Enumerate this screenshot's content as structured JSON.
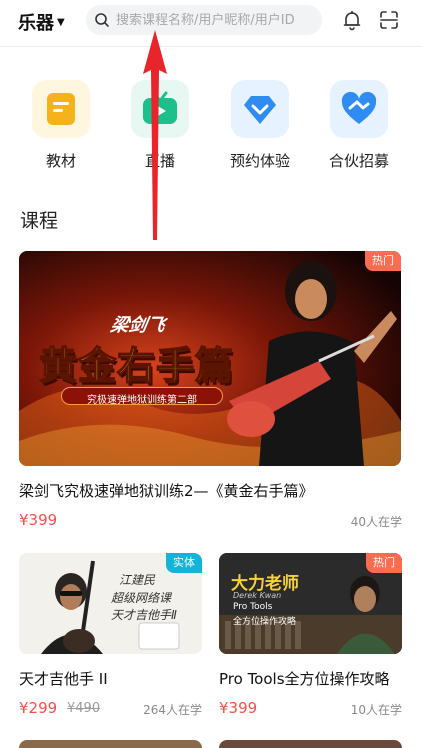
{
  "header": {
    "category_label": "乐器",
    "search_placeholder": "搜索课程名称/用户昵称/用户ID"
  },
  "quick_actions": [
    {
      "label": "教材"
    },
    {
      "label": "直播"
    },
    {
      "label": "预约体验"
    },
    {
      "label": "合伙招募"
    }
  ],
  "section": {
    "title": "课程"
  },
  "featured": {
    "badge": "热门",
    "banner_name": "梁剑飞",
    "banner_title": "黄金右手篇",
    "banner_subtitle": "究极速弹地狱训练第二部",
    "title": "梁剑飞究极速弹地狱训练2—《黄金右手篇》",
    "price": "¥399",
    "learners": "40人在学"
  },
  "cards": [
    {
      "badge": "实体",
      "calligraphy_lines": [
        "江建民",
        "超级网络课",
        "天才吉他手Ⅱ"
      ],
      "title": "天才吉他手 II",
      "price": "¥299",
      "old_price": "¥490",
      "learners": "264人在学"
    },
    {
      "badge": "热门",
      "banner_heading": "大力老师",
      "banner_name": "Derek Kwan",
      "banner_line1": "Pro Tools",
      "banner_line2": "全方位操作攻略",
      "title": "Pro Tools全方位操作攻略",
      "price": "¥399",
      "learners": "10人在学"
    }
  ],
  "colors": {
    "price": "#f5504d",
    "hot_badge": "#ff6b50",
    "physical_badge": "#14b4d8",
    "annotation_arrow": "#e8252b"
  },
  "icons": [
    "search-icon",
    "bell-icon",
    "scan-icon",
    "book-icon",
    "tv-icon",
    "check-heart-icon",
    "handshake-heart-icon"
  ]
}
